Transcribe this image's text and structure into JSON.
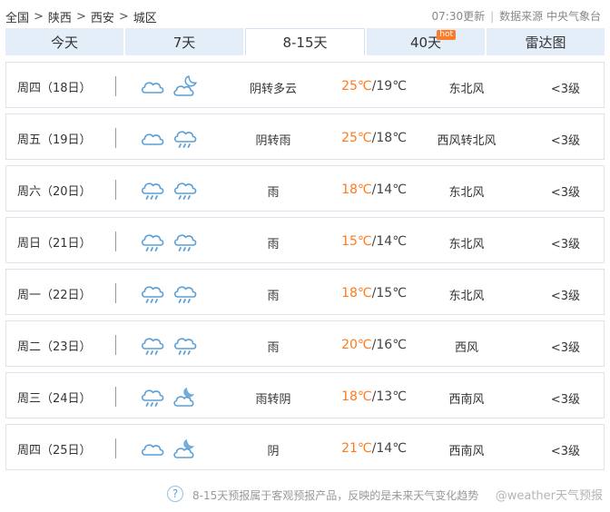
{
  "breadcrumb": {
    "items": [
      "全国",
      "陕西",
      "西安",
      "城区"
    ],
    "separator": ">"
  },
  "header": {
    "update_time": "07:30更新",
    "divider": "|",
    "source": "数据来源 中央气象台"
  },
  "tabs": [
    {
      "label": "今天",
      "active": false
    },
    {
      "label": "7天",
      "active": false
    },
    {
      "label": "8-15天",
      "active": true
    },
    {
      "label": "40天",
      "active": false,
      "badge": "hot"
    },
    {
      "label": "雷达图",
      "active": false
    }
  ],
  "temp_unit": "℃",
  "forecast": [
    {
      "day": "周四（18日）",
      "icons": [
        "cloudy-icon",
        "partly-cloudy-night-icon"
      ],
      "condition": "阴转多云",
      "high": "25",
      "low": "19",
      "wind": "东北风",
      "level": "<3级"
    },
    {
      "day": "周五（19日）",
      "icons": [
        "cloudy-icon",
        "rain-icon"
      ],
      "condition": "阴转雨",
      "high": "25",
      "low": "18",
      "wind": "西风转北风",
      "level": "<3级"
    },
    {
      "day": "周六（20日）",
      "icons": [
        "rain-icon",
        "rain-icon"
      ],
      "condition": "雨",
      "high": "18",
      "low": "14",
      "wind": "东北风",
      "level": "<3级"
    },
    {
      "day": "周日（21日）",
      "icons": [
        "rain-icon",
        "rain-icon"
      ],
      "condition": "雨",
      "high": "15",
      "low": "14",
      "wind": "东北风",
      "level": "<3级"
    },
    {
      "day": "周一（22日）",
      "icons": [
        "rain-icon",
        "rain-icon"
      ],
      "condition": "雨",
      "high": "18",
      "low": "15",
      "wind": "东北风",
      "level": "<3级"
    },
    {
      "day": "周二（23日）",
      "icons": [
        "rain-icon",
        "rain-icon"
      ],
      "condition": "雨",
      "high": "20",
      "low": "16",
      "wind": "西风",
      "level": "<3级"
    },
    {
      "day": "周三（24日）",
      "icons": [
        "rain-icon",
        "cloudy-night-icon"
      ],
      "condition": "雨转阴",
      "high": "18",
      "low": "13",
      "wind": "西南风",
      "level": "<3级"
    },
    {
      "day": "周四（25日）",
      "icons": [
        "cloudy-icon",
        "cloudy-night-icon"
      ],
      "condition": "阴",
      "high": "21",
      "low": "14",
      "wind": "西南风",
      "level": "<3级"
    }
  ],
  "footer": {
    "help_icon": "question-icon",
    "note": "8-15天预报属于客观预报产品，反映的是未来天气变化趋势",
    "watermark": "@weather天气预报"
  },
  "colors": {
    "accent_temp": "#ff7a1a",
    "tab_bg": "#e3eef9",
    "icon_stroke": "#5b9fd6"
  }
}
